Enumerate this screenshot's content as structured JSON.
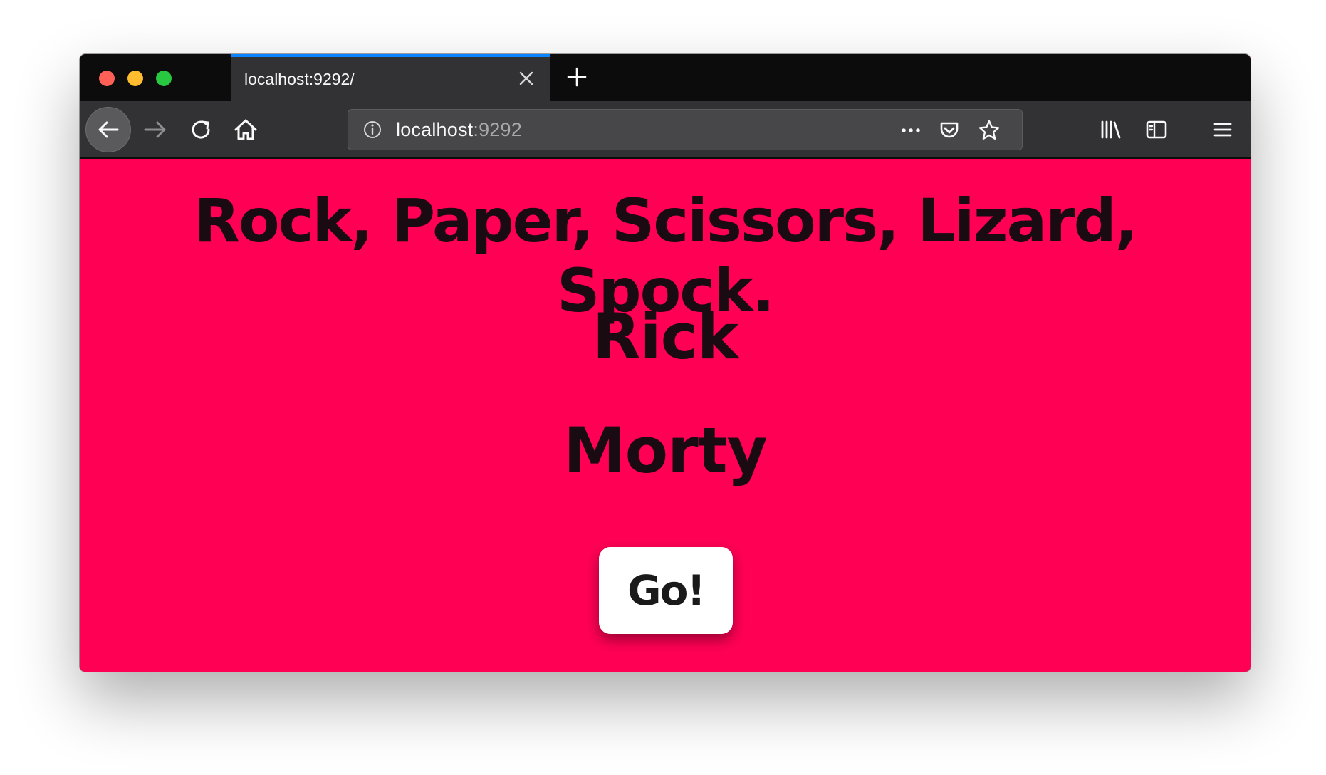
{
  "browser": {
    "tab": {
      "title": "localhost:9292/"
    },
    "url": {
      "host": "localhost",
      "port": ":9292"
    },
    "colors": {
      "tab_accent": "#0a84ff",
      "chrome_dark": "#0c0c0d",
      "chrome": "#323234"
    },
    "icons": {
      "back": "arrow-left-icon",
      "forward": "arrow-right-icon",
      "reload": "reload-icon",
      "home": "home-icon",
      "info": "info-icon",
      "page_actions": "more-dots-icon",
      "pocket": "pocket-icon",
      "bookmark": "star-icon",
      "library": "library-icon",
      "sidebar": "sidebar-icon",
      "menu": "hamburger-menu-icon",
      "close_tab": "close-icon",
      "new_tab": "plus-icon"
    }
  },
  "page": {
    "background_color": "#ff0055",
    "title": "Rock, Paper, Scissors, Lizard, Spock.",
    "player_one": "Rick",
    "player_two": "Morty",
    "go_button_label": "Go!"
  }
}
